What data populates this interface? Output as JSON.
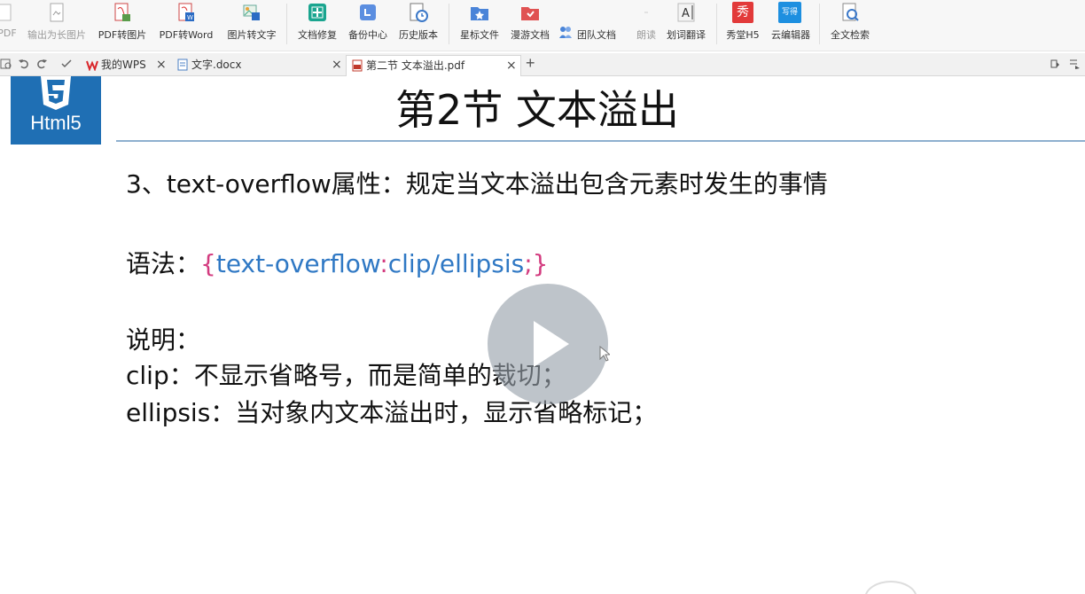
{
  "toolbar": {
    "items": [
      {
        "label": "PDF"
      },
      {
        "label": "输出为长图片"
      },
      {
        "label": "PDF转图片"
      },
      {
        "label": "PDF转Word"
      },
      {
        "label": "图片转文字"
      },
      {
        "label": "文档修复"
      },
      {
        "label": "备份中心"
      },
      {
        "label": "历史版本"
      },
      {
        "label": "星标文件"
      },
      {
        "label": "漫游文档"
      },
      {
        "label": "团队文档"
      },
      {
        "label": "朗读"
      },
      {
        "label": "划词翻译"
      },
      {
        "label": "秀堂H5"
      },
      {
        "label": "云编辑器"
      },
      {
        "label": "全文检索"
      }
    ],
    "badge_xiu": "秀",
    "badge_write": "写得"
  },
  "tabs": [
    {
      "label": "我的WPS",
      "close": "×"
    },
    {
      "label": "文字.docx",
      "close": "×"
    },
    {
      "label": "第二节 文本溢出.pdf",
      "close": "×"
    }
  ],
  "new_tab": "+",
  "slide": {
    "logo_text": "Html5",
    "title": "第2节 文本溢出",
    "line1": "3、text-overflow属性：规定当文本溢出包含元素时发生的事情",
    "syntax_label": "语法：",
    "syntax_open": "{",
    "syntax_prop": "text-overflow",
    "syntax_colon": ":",
    "syntax_value": "clip/ellipsis",
    "syntax_close": ";}",
    "desc_label": "说明：",
    "clip_line": "clip：不显示省略号，而是简单的裁切；",
    "ellipsis_line": "ellipsis：当对象内文本溢出时，显示省略标记；"
  },
  "colors": {
    "accent_blue": "#2f78c4",
    "accent_pink": "#d33b7f",
    "logo_blue": "#1f6fb4"
  }
}
